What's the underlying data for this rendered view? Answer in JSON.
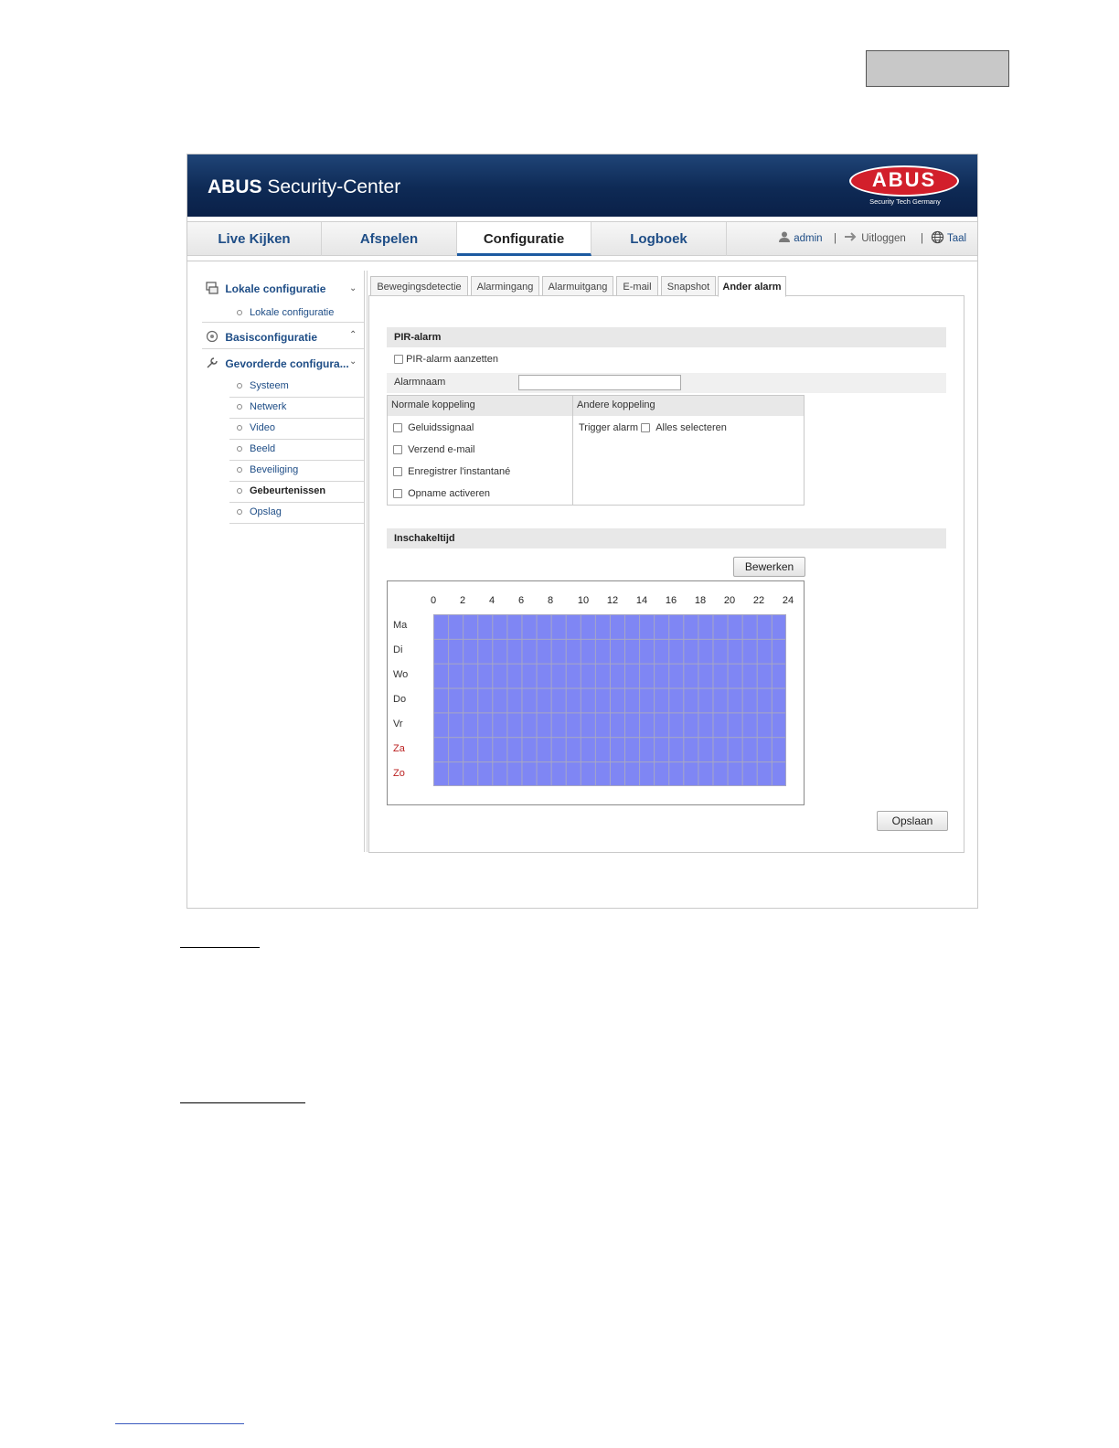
{
  "header": {
    "brand_bold": "ABUS",
    "brand_rest": " Security-Center",
    "logo_text": "ABUS",
    "logo_tagline": "Security Tech Germany"
  },
  "nav": {
    "tabs": [
      "Live Kijken",
      "Afspelen",
      "Configuratie",
      "Logboek"
    ],
    "active": "Configuratie",
    "user": "admin",
    "logout": "Uitloggen",
    "language": "Taal"
  },
  "sidebar": {
    "local": {
      "label": "Lokale configuratie",
      "items": [
        "Lokale configuratie"
      ]
    },
    "basic": {
      "label": "Basisconfiguratie"
    },
    "advanced": {
      "label": "Gevorderde configura...",
      "items": [
        "Systeem",
        "Netwerk",
        "Video",
        "Beeld",
        "Beveiliging",
        "Gebeurtenissen",
        "Opslag"
      ],
      "active": "Gebeurtenissen"
    }
  },
  "subtabs": [
    "Bewegingsdetectie",
    "Alarmingang",
    "Alarmuitgang",
    "E-mail",
    "Snapshot",
    "Ander alarm"
  ],
  "subtab_active": "Ander alarm",
  "pir": {
    "section_title": "PIR-alarm",
    "enable_label": "PIR-alarm aanzetten",
    "enabled": false,
    "alarm_name_label": "Alarmnaam",
    "alarm_name_value": ""
  },
  "linkage": {
    "normal_header": "Normale koppeling",
    "other_header": "Andere koppeling",
    "normal_items": [
      {
        "label": "Geluidssignaal",
        "checked": false
      },
      {
        "label": "Verzend e-mail",
        "checked": false
      },
      {
        "label": "Enregistrer l'instantané",
        "checked": false
      },
      {
        "label": "Opname activeren",
        "checked": false
      }
    ],
    "trigger_label": "Trigger alarm",
    "select_all_label": "Alles selecteren",
    "select_all_checked": false
  },
  "schedule": {
    "section_title": "Inschakeltijd",
    "edit_button": "Bewerken",
    "hours": [
      "0",
      "2",
      "4",
      "6",
      "8",
      "10",
      "12",
      "14",
      "16",
      "18",
      "20",
      "22",
      "24"
    ],
    "days": [
      "Ma",
      "Di",
      "Wo",
      "Do",
      "Vr",
      "Za",
      "Zo"
    ],
    "weekend_days": [
      "Za",
      "Zo"
    ],
    "coverage": "all day, every day",
    "fill_color": "#7f86f4"
  },
  "save_button": "Opslaan",
  "colors": {
    "banner": "#0e2a55",
    "accent": "#1e4d86",
    "logo_red": "#d21f2b"
  }
}
